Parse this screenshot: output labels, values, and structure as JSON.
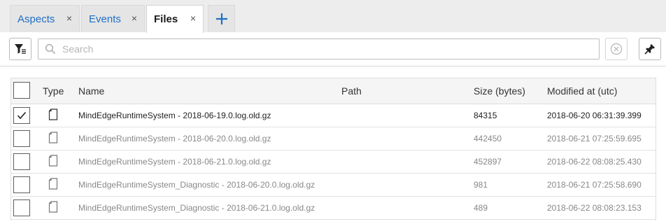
{
  "tabs": [
    {
      "label": "Aspects",
      "active": false
    },
    {
      "label": "Events",
      "active": false
    },
    {
      "label": "Files",
      "active": true
    }
  ],
  "tab_close_glyph": "×",
  "add_tab_glyph": "+",
  "toolbar": {
    "filter_icon": "filter-list-icon",
    "search_placeholder": "Search",
    "search_value": "",
    "clear_icon": "clear-circle-icon",
    "pin_icon": "pin-icon"
  },
  "table": {
    "columns": {
      "type": "Type",
      "name": "Name",
      "path": "Path",
      "size": "Size (bytes)",
      "modified": "Modified at (utc)"
    },
    "rows": [
      {
        "name": "MindEdgeRuntimeSystem - 2018-06-19.0.log.old.gz",
        "path": "",
        "size": "84315",
        "modified": "2018-06-20 06:31:39.399",
        "selected": true
      },
      {
        "name": "MindEdgeRuntimeSystem - 2018-06-20.0.log.old.gz",
        "path": "",
        "size": "442450",
        "modified": "2018-06-21 07:25:59.695",
        "selected": false
      },
      {
        "name": "MindEdgeRuntimeSystem - 2018-06-21.0.log.old.gz",
        "path": "",
        "size": "452897",
        "modified": "2018-06-22 08:08:25.430",
        "selected": false
      },
      {
        "name": "MindEdgeRuntimeSystem_Diagnostic - 2018-06-20.0.log.old.gz",
        "path": "",
        "size": "981",
        "modified": "2018-06-21 07:25:58.690",
        "selected": false
      },
      {
        "name": "MindEdgeRuntimeSystem_Diagnostic - 2018-06-21.0.log.old.gz",
        "path": "",
        "size": "489",
        "modified": "2018-06-22 08:08:23.153",
        "selected": false
      }
    ]
  },
  "colors": {
    "accent": "#1f6fc5",
    "tab_bar_bg": "#ededed",
    "header_bg": "#f5f5f5",
    "muted_text": "#888888"
  }
}
